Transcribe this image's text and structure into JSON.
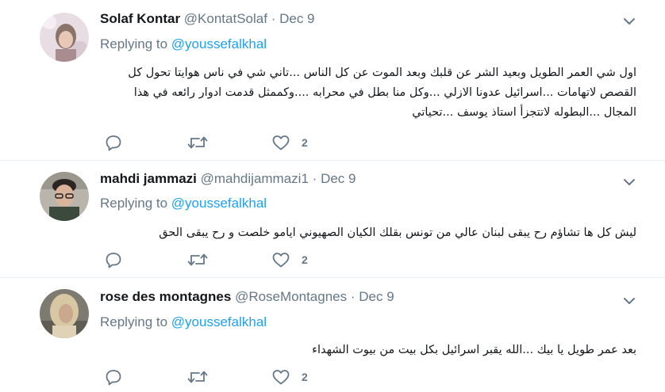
{
  "tweets": [
    {
      "name": "Solaf Kontar",
      "handle": "@KontatSolaf",
      "sep": "·",
      "date": "Dec 9",
      "replying_label": "Replying to",
      "replying_to": "@youssefalkhal",
      "text": "اول شي العمر الطويل وبعيد الشر عن قلبك وبعد الموت عن كل الناس ...تاني شي في ناس هوايتا تحول كل القصص لاتهامات ...اسرائيل عدونا الازلي ...وكل منا بطل في محرابه ....وكممثل قدمت ادوار رائعه في هذا المجال ...البطوله لاتتجزأ استاذ يوسف ...تحياتي",
      "likes": "2"
    },
    {
      "name": "mahdi jammazi",
      "handle": "@mahdijammazi1",
      "sep": "·",
      "date": "Dec 9",
      "replying_label": "Replying to",
      "replying_to": "@youssefalkhal",
      "text": "ليش كل ها تشاؤم رح يبقى لبنان عالي من تونس بقلك الكيان الصهيوني ايامو خلصت و رح يبقى الحق",
      "likes": "2"
    },
    {
      "name": "rose des montagnes",
      "handle": "@RoseMontagnes",
      "sep": "·",
      "date": "Dec 9",
      "replying_label": "Replying to",
      "replying_to": "@youssefalkhal",
      "text": "بعد عمر طويل يا بيك ...الله يقبر اسرائيل بكل بيت من بيوت الشهداء",
      "likes": "2"
    }
  ],
  "icons": {
    "reply": "reply-icon",
    "retweet": "retweet-icon",
    "like": "heart-icon",
    "menu": "chevron-down-icon"
  },
  "colors": {
    "link": "#1da1f2",
    "secondary_text": "#657786",
    "divider": "#e6ecf0"
  }
}
